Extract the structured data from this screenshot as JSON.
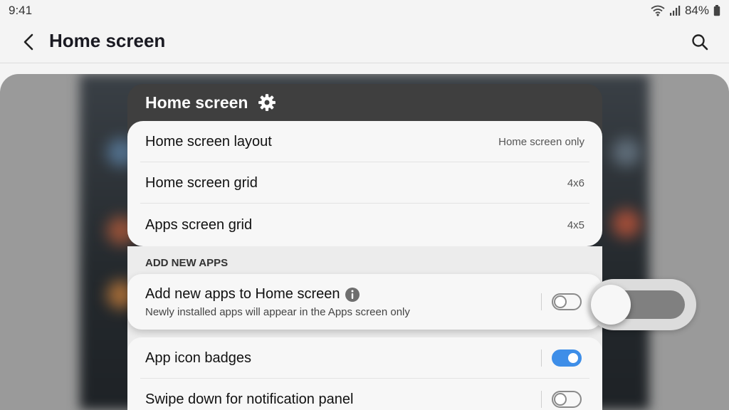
{
  "status_bar": {
    "time": "9:41",
    "battery": "84%",
    "icons": [
      "wifi-icon",
      "signal-icon",
      "battery-icon"
    ]
  },
  "app_bar": {
    "title": "Home screen",
    "back_icon": "chevron-left-icon",
    "search_icon": "search-icon"
  },
  "panel": {
    "title": "Home screen",
    "settings_icon": "gear-icon",
    "rows": [
      {
        "label": "Home screen layout",
        "value": "Home screen only"
      },
      {
        "label": "Home screen grid",
        "value": "4x6"
      },
      {
        "label": "Apps screen grid",
        "value": "4x5"
      }
    ],
    "section_label": "ADD NEW APPS",
    "add_new_apps": {
      "title": "Add new apps to Home screen",
      "description": "Newly installed apps will appear in the Apps screen only",
      "enabled": false
    },
    "toggles": [
      {
        "label": "App icon badges",
        "enabled": true
      },
      {
        "label": "Swipe down for notification panel",
        "enabled": false
      }
    ]
  },
  "colors": {
    "accent": "#3e8ee8",
    "panel_header": "#3f3f3f",
    "background": "#f4f4f4"
  }
}
